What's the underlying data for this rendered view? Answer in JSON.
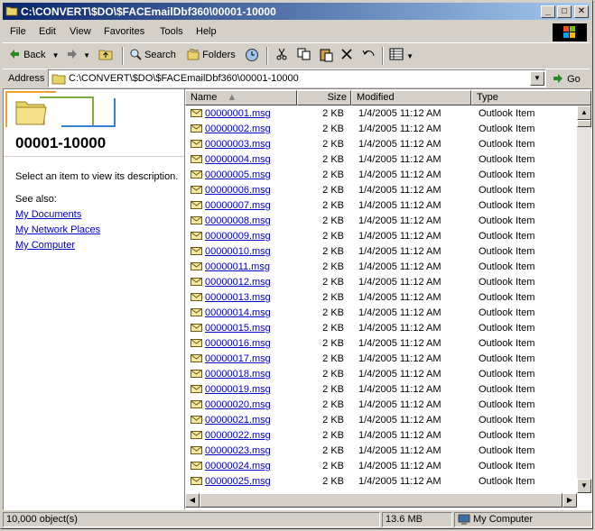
{
  "window": {
    "title": "C:\\CONVERT\\$DO\\$FACEmailDbf360\\00001-10000",
    "minimize_glyph": "_",
    "maximize_glyph": "□",
    "close_glyph": "✕"
  },
  "menu": [
    "File",
    "Edit",
    "View",
    "Favorites",
    "Tools",
    "Help"
  ],
  "toolbar": {
    "back_label": "Back",
    "search_label": "Search",
    "folders_label": "Folders",
    "icons": [
      "back-arrow-icon",
      "forward-arrow-icon",
      "up-folder-icon",
      "search-icon",
      "folders-icon",
      "history-icon",
      "cut-icon",
      "copy-icon",
      "paste-icon",
      "delete-icon",
      "undo-icon",
      "views-icon"
    ]
  },
  "address": {
    "label": "Address",
    "path": "C:\\CONVERT\\$DO\\$FACEmailDbf360\\00001-10000",
    "go_label": "Go"
  },
  "left_pane": {
    "folder_name": "00001-10000",
    "description": "Select an item to view its description.",
    "see_also_label": "See also:",
    "links": [
      "My Documents",
      "My Network Places",
      "My Computer"
    ]
  },
  "columns": {
    "name": "Name",
    "size": "Size",
    "modified": "Modified",
    "type": "Type"
  },
  "files": [
    {
      "name": "00000001.msg",
      "size": "2 KB",
      "modified": "1/4/2005 11:12 AM",
      "type": "Outlook Item"
    },
    {
      "name": "00000002.msg",
      "size": "2 KB",
      "modified": "1/4/2005 11:12 AM",
      "type": "Outlook Item"
    },
    {
      "name": "00000003.msg",
      "size": "2 KB",
      "modified": "1/4/2005 11:12 AM",
      "type": "Outlook Item"
    },
    {
      "name": "00000004.msg",
      "size": "2 KB",
      "modified": "1/4/2005 11:12 AM",
      "type": "Outlook Item"
    },
    {
      "name": "00000005.msg",
      "size": "2 KB",
      "modified": "1/4/2005 11:12 AM",
      "type": "Outlook Item"
    },
    {
      "name": "00000006.msg",
      "size": "2 KB",
      "modified": "1/4/2005 11:12 AM",
      "type": "Outlook Item"
    },
    {
      "name": "00000007.msg",
      "size": "2 KB",
      "modified": "1/4/2005 11:12 AM",
      "type": "Outlook Item"
    },
    {
      "name": "00000008.msg",
      "size": "2 KB",
      "modified": "1/4/2005 11:12 AM",
      "type": "Outlook Item"
    },
    {
      "name": "00000009.msg",
      "size": "2 KB",
      "modified": "1/4/2005 11:12 AM",
      "type": "Outlook Item"
    },
    {
      "name": "00000010.msg",
      "size": "2 KB",
      "modified": "1/4/2005 11:12 AM",
      "type": "Outlook Item"
    },
    {
      "name": "00000011.msg",
      "size": "2 KB",
      "modified": "1/4/2005 11:12 AM",
      "type": "Outlook Item"
    },
    {
      "name": "00000012.msg",
      "size": "2 KB",
      "modified": "1/4/2005 11:12 AM",
      "type": "Outlook Item"
    },
    {
      "name": "00000013.msg",
      "size": "2 KB",
      "modified": "1/4/2005 11:12 AM",
      "type": "Outlook Item"
    },
    {
      "name": "00000014.msg",
      "size": "2 KB",
      "modified": "1/4/2005 11:12 AM",
      "type": "Outlook Item"
    },
    {
      "name": "00000015.msg",
      "size": "2 KB",
      "modified": "1/4/2005 11:12 AM",
      "type": "Outlook Item"
    },
    {
      "name": "00000016.msg",
      "size": "2 KB",
      "modified": "1/4/2005 11:12 AM",
      "type": "Outlook Item"
    },
    {
      "name": "00000017.msg",
      "size": "2 KB",
      "modified": "1/4/2005 11:12 AM",
      "type": "Outlook Item"
    },
    {
      "name": "00000018.msg",
      "size": "2 KB",
      "modified": "1/4/2005 11:12 AM",
      "type": "Outlook Item"
    },
    {
      "name": "00000019.msg",
      "size": "2 KB",
      "modified": "1/4/2005 11:12 AM",
      "type": "Outlook Item"
    },
    {
      "name": "00000020.msg",
      "size": "2 KB",
      "modified": "1/4/2005 11:12 AM",
      "type": "Outlook Item"
    },
    {
      "name": "00000021.msg",
      "size": "2 KB",
      "modified": "1/4/2005 11:12 AM",
      "type": "Outlook Item"
    },
    {
      "name": "00000022.msg",
      "size": "2 KB",
      "modified": "1/4/2005 11:12 AM",
      "type": "Outlook Item"
    },
    {
      "name": "00000023.msg",
      "size": "2 KB",
      "modified": "1/4/2005 11:12 AM",
      "type": "Outlook Item"
    },
    {
      "name": "00000024.msg",
      "size": "2 KB",
      "modified": "1/4/2005 11:12 AM",
      "type": "Outlook Item"
    },
    {
      "name": "00000025.msg",
      "size": "2 KB",
      "modified": "1/4/2005 11:12 AM",
      "type": "Outlook Item"
    }
  ],
  "status": {
    "objects": "10,000 object(s)",
    "size": "13.6 MB",
    "zone": "My Computer"
  },
  "colors": {
    "title_start": "#0a246a",
    "title_end": "#a6caf0",
    "link": "#0000cc",
    "face": "#d4d0c8"
  }
}
